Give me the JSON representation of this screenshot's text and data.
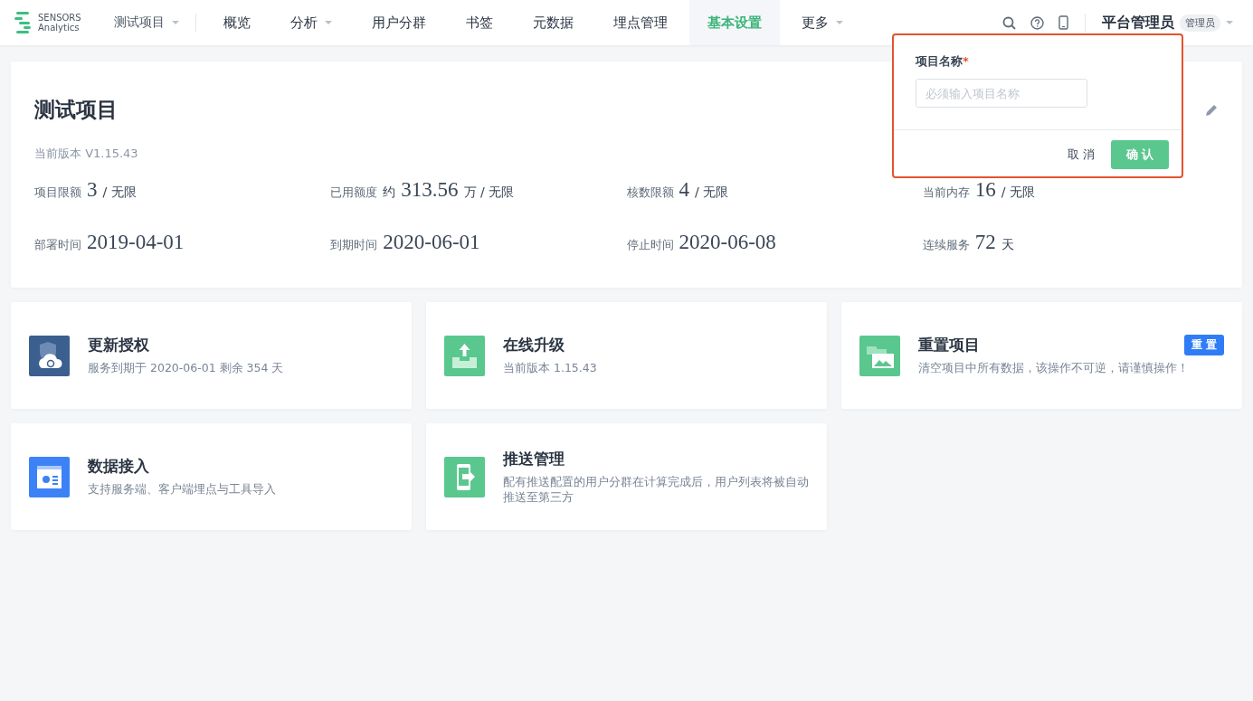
{
  "header": {
    "logo": {
      "line1": "SENSORS",
      "line2": "Analytics"
    },
    "project": "测试项目",
    "nav": [
      {
        "label": "概览",
        "dropdown": false,
        "selected": false
      },
      {
        "label": "分析",
        "dropdown": true,
        "selected": false
      },
      {
        "label": "用户分群",
        "dropdown": false,
        "selected": false
      },
      {
        "label": "书签",
        "dropdown": false,
        "selected": false
      },
      {
        "label": "元数据",
        "dropdown": false,
        "selected": false
      },
      {
        "label": "埋点管理",
        "dropdown": false,
        "selected": false
      },
      {
        "label": "基本设置",
        "dropdown": false,
        "selected": true
      },
      {
        "label": "更多",
        "dropdown": true,
        "selected": false
      }
    ],
    "user": {
      "name": "平台管理员",
      "role": "管理员"
    }
  },
  "project_card": {
    "title": "测试项目",
    "version": "当前版本 V1.15.43",
    "stats": [
      {
        "label": "项目限额",
        "value": "3",
        "suffix": "/ 无限"
      },
      {
        "label": "已用额度",
        "prefix": "约",
        "value": "313.56",
        "suffix": "万 / 无限"
      },
      {
        "label": "核数限额",
        "value": "4",
        "suffix": "/ 无限"
      },
      {
        "label": "当前内存",
        "value": "16",
        "suffix": "/ 无限"
      },
      {
        "label": "部署时间",
        "value": "2019-04-01"
      },
      {
        "label": "到期时间",
        "value": "2020-06-01"
      },
      {
        "label": "停止时间",
        "value": "2020-06-08"
      },
      {
        "label": "连续服务",
        "value": "72",
        "suffix": "天"
      }
    ]
  },
  "popover": {
    "label": "项目名称",
    "required_mark": "*",
    "placeholder": "必须输入项目名称",
    "cancel": "取 消",
    "confirm": "确 认"
  },
  "features": [
    {
      "kind": "license",
      "title": "更新授权",
      "description": "服务到期于 2020-06-01 剩余 354 天"
    },
    {
      "kind": "upgrade",
      "title": "在线升级",
      "description": "当前版本 1.15.43"
    },
    {
      "kind": "reset",
      "title": "重置项目",
      "description": "清空项目中所有数据，该操作不可逆，请谨慎操作！",
      "action": "重 置"
    },
    {
      "kind": "data",
      "title": "数据接入",
      "description": "支持服务端、客户端埋点与工具导入"
    },
    {
      "kind": "push",
      "title": "推送管理",
      "description": "配有推送配置的用户分群在计算完成后，用户列表将被自动推送至第三方"
    }
  ]
}
